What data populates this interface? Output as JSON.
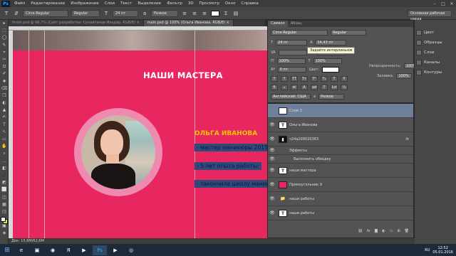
{
  "app": {
    "logo": "Ps"
  },
  "menu": [
    "Файл",
    "Редактирование",
    "Изображение",
    "Слои",
    "Текст",
    "Выделение",
    "Фильтр",
    "3D",
    "Просмотр",
    "Окно",
    "Справка"
  ],
  "window_controls": [
    "–",
    "□",
    "✕"
  ],
  "options_bar": {
    "tool_icon": "T",
    "font_family": "Circe Regular",
    "font_style": "Regular",
    "size_icon": "T",
    "font_size": "24 пт",
    "aa_label": "a",
    "aa_mode": "Резкое",
    "workspace": "Основная рабочая среда",
    "text_color": "#ffffff"
  },
  "tabs": [
    {
      "label": "finish.psd @ 66,7% (Сайт разработки: Сунайтанов Ильдар, RGB/8) ×",
      "active": false
    },
    {
      "label": "main.psd @ 100% (Ольга Иванова, RGB/8) ×",
      "active": true
    }
  ],
  "tools": [
    "▸",
    "⬚",
    "◯",
    "✎",
    "⌖",
    "✂",
    "⊡",
    "✐",
    "✚",
    "⌫",
    "❒",
    "◐",
    "▲",
    "✍",
    "T",
    "↖",
    "▭",
    "✋",
    "⌕",
    "…",
    "◧",
    "⬛",
    "◩",
    "⬜",
    "◫",
    "▦",
    "◳",
    "⊞",
    "▣",
    "◈"
  ],
  "canvas": {
    "heading": "НАШИ МАСТЕРА",
    "name": "ОЛЬГА ИВАНОВА",
    "bullets": [
      "- мастер маникюры 2015;",
      "- 5 лет опыта работы;",
      "- закончила школу маникюра."
    ],
    "background": "#e8265f",
    "accent": "#f5c400"
  },
  "char_panel": {
    "tabs": [
      "Символ",
      "Абзац"
    ],
    "font_family": "Circe Regular",
    "font_style": "Regular",
    "font_size": "24 пт",
    "leading": "54,43 пт",
    "tracking": "0",
    "vscale": "100%",
    "hscale": "100%",
    "baseline": "0 пт",
    "color_label": "Цвет:",
    "language": "Английский: США",
    "aa_label": "a",
    "aa_mode": "Резкое",
    "tooltip": "Задайте интерлиньяж",
    "style_buttons": [
      "T",
      "T",
      "TT",
      "Tт",
      "T¹",
      "T₁",
      "T",
      "Ŧ"
    ],
    "ot_buttons": [
      "fi",
      "ℴ",
      "st",
      "A",
      "ad",
      "T",
      "1st",
      "½"
    ],
    "opacity_label": "Непрозрачность:",
    "opacity": "100%",
    "fill_label": "Заливка:",
    "fill": "100%"
  },
  "layers": [
    {
      "name": "Слой 3",
      "thumb": "",
      "selected": true,
      "fx": false
    },
    {
      "name": "Ольга Иванова",
      "thumb": "T",
      "selected": false,
      "fx": false
    },
    {
      "name": "ч24a209020383",
      "thumb": "▮",
      "selected": false,
      "fx": true
    },
    {
      "name": "Эффекты",
      "thumb": "",
      "selected": false,
      "fx": false
    },
    {
      "name": "Выполнить обводку",
      "thumb": "",
      "selected": false,
      "fx": false
    },
    {
      "name": "наши мастера",
      "thumb": "T",
      "selected": false,
      "fx": false
    },
    {
      "name": "Прямоугольник 9",
      "thumb": "",
      "selected": false,
      "fx": false
    },
    {
      "name": "наши работы",
      "thumb": "📁",
      "selected": false,
      "fx": false
    },
    {
      "name": "наши работы",
      "thumb": "T",
      "selected": false,
      "fx": false
    }
  ],
  "side_panels": [
    "Цвет",
    "Образцы",
    "Слои",
    "Каналы",
    "Контуры"
  ],
  "status": "Док: 15,6M/62,6M",
  "taskbar": {
    "apps": [
      "⊞",
      "e",
      "▣",
      "◉",
      "Я",
      "▶",
      "Ps",
      "▶",
      "◎"
    ],
    "clock_time": "12:52",
    "clock_date": "05.01.2016",
    "lang": "RU"
  }
}
